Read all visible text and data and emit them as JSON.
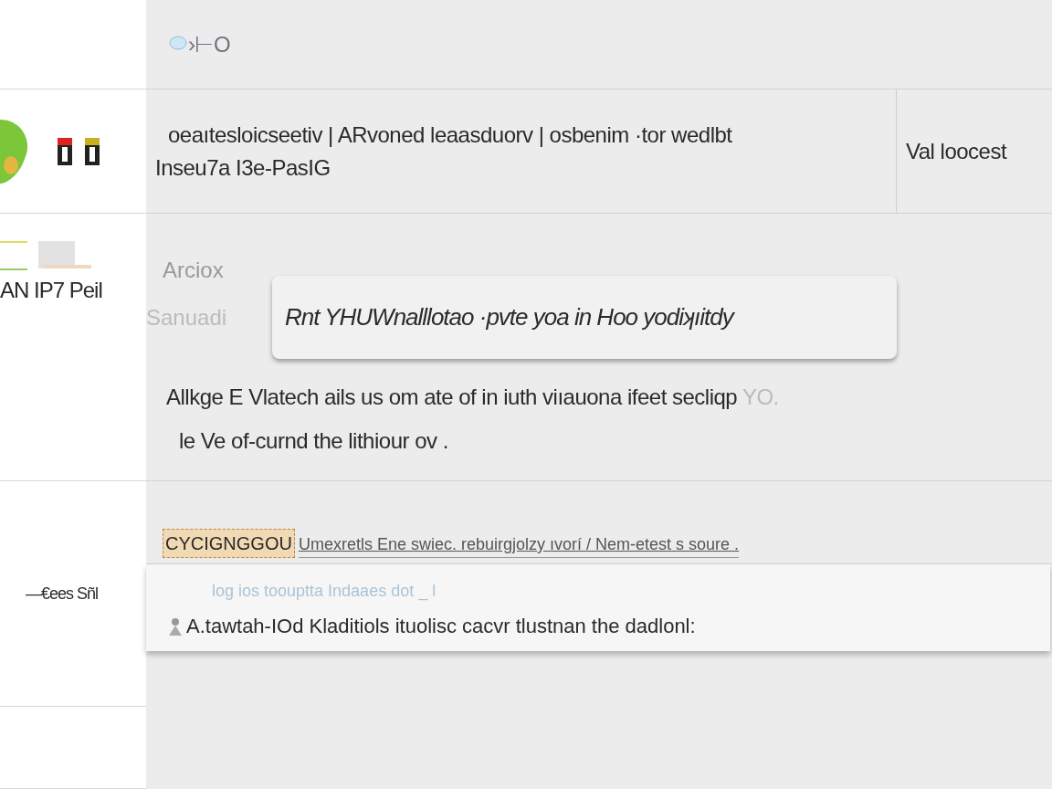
{
  "header": {
    "text": "›⊢O"
  },
  "sidebar": {
    "items": [
      {
        "kind": "icons"
      },
      {
        "kind": "label",
        "text": "AN IP7 Peil"
      },
      {
        "kind": "label",
        "text": "—€ees Sñl"
      }
    ]
  },
  "rows": [
    {
      "kind": "columns",
      "text": "oeaıtesloicseetiv | ARvoned leaasduorv | osbenim ·tor wedlbt",
      "side": "Val loocest",
      "second": "Inseu7a I3e-PasIG"
    },
    {
      "kind": "callout",
      "label": "Arciox",
      "dim": "Sanuadi",
      "card": "Rnt YHUWnalllotao ·pvte yoa in Hoo yodiʞıitdy",
      "para": "Allkge E Vlatech ails us om ate of in iuth viıauona ifeet secliqp",
      "para_faded": "YO.",
      "para2": "le Ve of-curnd the lithiour ov ."
    },
    {
      "kind": "tagline",
      "tag": "CYCIGNGGOU",
      "link": "Umexretls Ene swiec. rebuirgjolzy ıvorí / Nem-etest s soure ."
    }
  ],
  "popup": {
    "hint": "log ios toouptta Indaaes dot _ l",
    "text": "A.tawtah-IOd Kladitiols ituolisc cacvr tlustnan the dadlonl:"
  }
}
